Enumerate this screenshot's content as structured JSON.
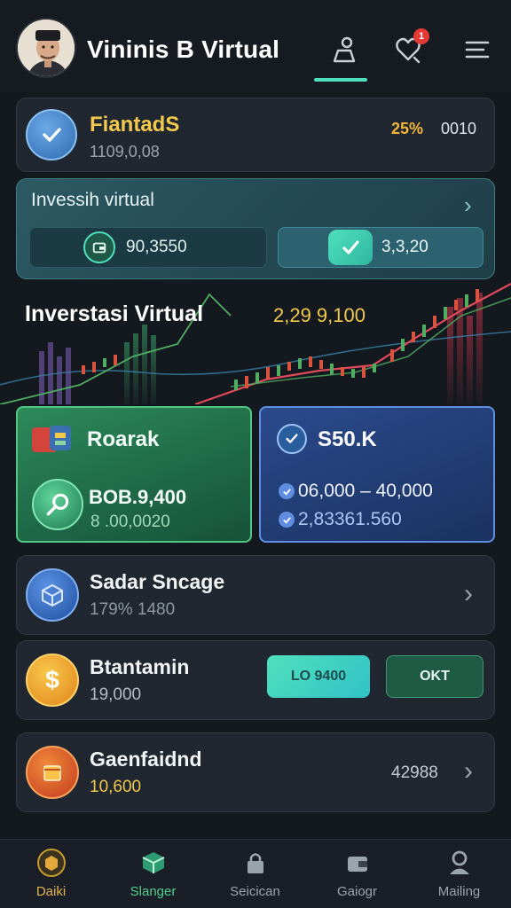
{
  "header": {
    "title": "Vininis B Virtual",
    "notification_count": "1",
    "icons": [
      "person-icon",
      "heart-chat-icon",
      "menu-icon"
    ]
  },
  "balance": {
    "title": "FiantadS",
    "amount": "1109,0,08",
    "percent": "25%",
    "value": "0010",
    "icon": "check-shield-icon"
  },
  "invest": {
    "title": "Invessih virtual",
    "left_value": "90,3550",
    "right_value": "3,3,20",
    "left_icon": "wallet-icon",
    "right_icon": "check-icon"
  },
  "chart": {
    "title": "Inverstasi Virtual",
    "value": "2,29 9,100"
  },
  "tiles": {
    "green": {
      "title": "Roarak",
      "value_main": "BOB.9,400",
      "value_sub": "8 .00,0020",
      "icon": "wallet-icon",
      "sub_icon": "search-icon"
    },
    "blue": {
      "title": "S50.K",
      "line1": "06,000 – 40,000",
      "line2": "2,83361.560",
      "icon": "check-circle-icon"
    }
  },
  "rows": [
    {
      "title": "Sadar Sncage",
      "sub": "179% 1480",
      "icon": "cube-icon",
      "has_chevron": true
    },
    {
      "title": "Btantamin",
      "sub": "19,000",
      "icon": "dollar-coin-icon",
      "btn1": "LO 9400",
      "btn2": "OKT"
    },
    {
      "title": "Gaenfaidnd",
      "sub": "10,600",
      "icon": "box-icon",
      "value": "42988",
      "has_chevron": true
    }
  ],
  "nav": [
    {
      "label": "Daiki",
      "icon": "box-icon",
      "active": true
    },
    {
      "label": "Slanger",
      "icon": "cube-icon"
    },
    {
      "label": "Seicican",
      "icon": "lock-icon"
    },
    {
      "label": "Gaiogr",
      "icon": "wallet-icon"
    },
    {
      "label": "Mailing",
      "icon": "person-icon"
    }
  ],
  "colors": {
    "background": "#14191f",
    "accent_teal": "#4fe0bd",
    "gold": "#f2c94c",
    "green_tile": "#2d8a5a",
    "blue_tile": "#2b4a8c",
    "orange_badge": "#f2b53a",
    "notif_red": "#e53935"
  }
}
